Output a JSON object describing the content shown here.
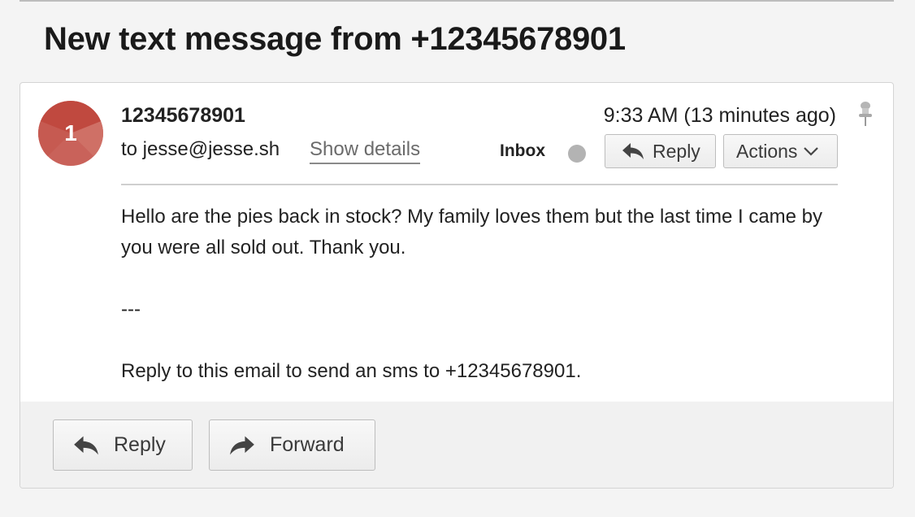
{
  "subject": "New text message from +12345678901",
  "message": {
    "avatar_letter": "1",
    "sender": "12345678901",
    "to_line": "to jesse@jesse.sh",
    "show_details_label": "Show details",
    "timestamp": "9:33 AM (13 minutes ago)",
    "folder": "Inbox",
    "reply_label": "Reply",
    "actions_label": "Actions",
    "body": {
      "paragraph1": "Hello are the pies back in stock? My family loves them but the last time I came by you were all sold out. Thank you.",
      "separator": "---",
      "paragraph2": "Reply to this email to send an sms to +12345678901."
    }
  },
  "footer": {
    "reply_label": "Reply",
    "forward_label": "Forward"
  },
  "colors": {
    "avatar": "#c9625a",
    "status_dot": "#b3b3b3"
  },
  "icons": [
    "reply-icon",
    "chevron-down-icon",
    "forward-icon",
    "pin-icon"
  ]
}
